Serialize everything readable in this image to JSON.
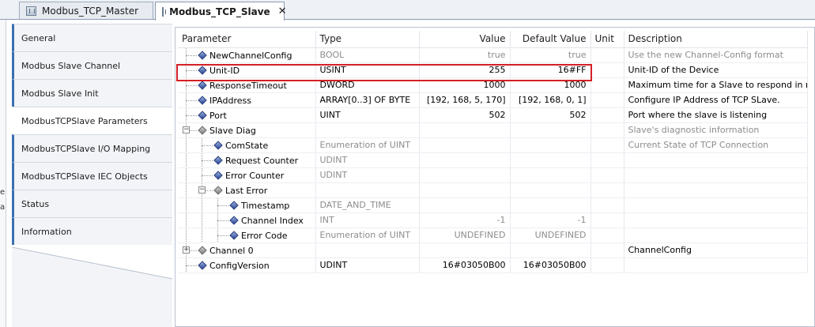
{
  "tabs": [
    {
      "label": "Modbus_TCP_Master"
    },
    {
      "label": "Modbus_TCP_Slave",
      "close": "✕"
    }
  ],
  "left_edge_fragments": [
    "e",
    "a"
  ],
  "nav": {
    "items": [
      {
        "label": "General"
      },
      {
        "label": "Modbus Slave Channel"
      },
      {
        "label": "Modbus Slave Init"
      },
      {
        "label": "ModbusTCPSlave Parameters"
      },
      {
        "label": "ModbusTCPSlave I/O Mapping"
      },
      {
        "label": "ModbusTCPSlave IEC Objects"
      },
      {
        "label": "Status"
      },
      {
        "label": "Information"
      }
    ],
    "selected_index": 3
  },
  "grid": {
    "headers": {
      "parameter": "Parameter",
      "type": "Type",
      "value": "Value",
      "default": "Default Value",
      "unit": "Unit",
      "description": "Description"
    },
    "rows": [
      {
        "name": "NewChannelConfig",
        "type": "BOOL",
        "value": "true",
        "default": "true",
        "unit": "",
        "description": "Use the new Channel-Config format"
      },
      {
        "name": "Unit-ID",
        "type": "USINT",
        "value": "255",
        "default": "16#FF",
        "unit": "",
        "description": "Unit-ID of the Device"
      },
      {
        "name": "ResponseTimeout",
        "type": "DWORD",
        "value": "1000",
        "default": "1000",
        "unit": "",
        "description": "Maximum time for a Slave to respond in ms"
      },
      {
        "name": "IPAddress",
        "type": "ARRAY[0..3] OF BYTE",
        "value": "[192, 168, 5, 170]",
        "default": "[192, 168, 0, 1]",
        "unit": "",
        "description": "Configure IP Address of TCP SLave."
      },
      {
        "name": "Port",
        "type": "UINT",
        "value": "502",
        "default": "502",
        "unit": "",
        "description": "Port where the slave is listening"
      },
      {
        "name": "Slave Diag",
        "type": "",
        "value": "",
        "default": "",
        "unit": "",
        "description": "Slave's diagnostic information",
        "expander": "−"
      },
      {
        "name": "ComState",
        "type": "Enumeration of UINT",
        "value": "",
        "default": "",
        "unit": "",
        "description": "Current State of TCP Connection"
      },
      {
        "name": "Request Counter",
        "type": "UDINT",
        "value": "",
        "default": "",
        "unit": "",
        "description": ""
      },
      {
        "name": "Error Counter",
        "type": "UDINT",
        "value": "",
        "default": "",
        "unit": "",
        "description": ""
      },
      {
        "name": "Last Error",
        "type": "",
        "value": "",
        "default": "",
        "unit": "",
        "description": "",
        "expander": "−"
      },
      {
        "name": "Timestamp",
        "type": "DATE_AND_TIME",
        "value": "",
        "default": "",
        "unit": "",
        "description": ""
      },
      {
        "name": "Channel Index",
        "type": "INT",
        "value": "-1",
        "default": "-1",
        "unit": "",
        "description": ""
      },
      {
        "name": "Error Code",
        "type": "Enumeration of UINT",
        "value": "UNDEFINED",
        "default": "UNDEFINED",
        "unit": "",
        "description": ""
      },
      {
        "name": "Channel 0",
        "type": "",
        "value": "",
        "default": "",
        "unit": "",
        "description": "ChannelConfig",
        "expander": "+"
      },
      {
        "name": "ConfigVersion",
        "type": "UDINT",
        "value": "16#03050B00",
        "default": "16#03050B00",
        "unit": "",
        "description": ""
      }
    ]
  },
  "colors": {
    "highlight": "#d51f26",
    "nav_accent": "#3c6fb0"
  },
  "icons": {
    "parameter": "parameter-gem-icon",
    "tab": "device-tab-icon",
    "close": "close-icon"
  }
}
